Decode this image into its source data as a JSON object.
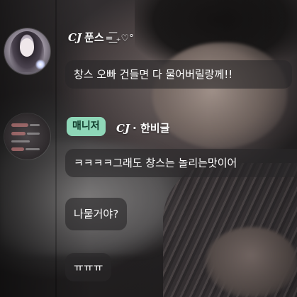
{
  "messages": [
    {
      "username_prefix": "CJ",
      "username": "푼스",
      "username_deco": "=͟͟͞ ₊♡°",
      "text": "창스 오빠 건들면 다 물어버릴랑께!!"
    },
    {
      "badge": "매니저",
      "username_prefix": "CJ",
      "username": "· 한비글",
      "texts": [
        "ㅋㅋㅋㅋ그래도 창스는 놀리는맛이어",
        "나물거야?",
        "ㅠㅠㅠ"
      ]
    }
  ],
  "colors": {
    "badge_bg": "#8fd7b8",
    "bubble_bg": "rgba(40,38,40,0.62)",
    "text": "#ffffff"
  }
}
